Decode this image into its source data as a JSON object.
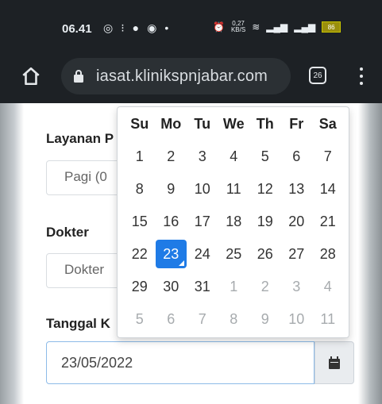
{
  "statusbar": {
    "time": "06.41",
    "network_speed_top": "0,27",
    "network_speed_bottom": "KB/S",
    "battery": "86"
  },
  "browser": {
    "url": "iasat.klinikspnjabar.com",
    "tab_count": "26"
  },
  "form": {
    "layanan_label": "Layanan P",
    "layanan_value": "Pagi (0",
    "dokter_label": "Dokter",
    "dokter_value": "Dokter",
    "tanggal_label": "Tanggal K",
    "tanggal_value": "23/05/2022"
  },
  "datepicker": {
    "weekdays": [
      "Su",
      "Mo",
      "Tu",
      "We",
      "Th",
      "Fr",
      "Sa"
    ],
    "weeks": [
      [
        "1",
        "2",
        "3",
        "4",
        "5",
        "6",
        "7"
      ],
      [
        "8",
        "9",
        "10",
        "11",
        "12",
        "13",
        "14"
      ],
      [
        "15",
        "16",
        "17",
        "18",
        "19",
        "20",
        "21"
      ],
      [
        "22",
        "23",
        "24",
        "25",
        "26",
        "27",
        "28"
      ],
      [
        "29",
        "30",
        "31",
        "1",
        "2",
        "3",
        "4"
      ],
      [
        "5",
        "6",
        "7",
        "8",
        "9",
        "10",
        "11"
      ]
    ],
    "selected": "23",
    "accent_color": "#1f7be6"
  }
}
